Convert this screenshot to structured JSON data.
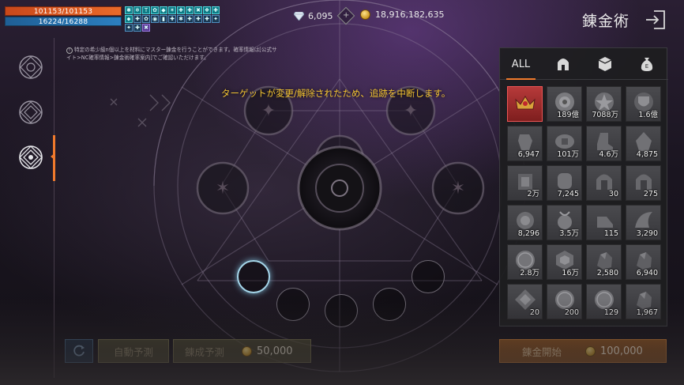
{
  "player": {
    "hp": "101153/101153",
    "mp": "16224/16288"
  },
  "buffs": {
    "row1": [
      "✱",
      "❄",
      "T",
      "✿",
      "◆",
      "✶",
      "✚",
      "✚",
      "✖",
      "❖",
      "✚",
      "⬥"
    ],
    "row2": [
      "✚",
      "✿",
      "◉",
      "▮",
      "✚",
      "✱",
      "✚",
      "✚",
      "✚",
      "✦",
      "✦",
      "✚"
    ],
    "row3": [
      "✖"
    ]
  },
  "currency": {
    "diamonds": "6,095",
    "adena": "18,916,182,635"
  },
  "header": {
    "title": "錬金術"
  },
  "notice": {
    "text": "特定の希少級n個以上を材料にマスター錬金を行うことができます。確率情報は[公式サイト>NC確率情報>錬金術確率案内]でご確認いただけます。"
  },
  "message": {
    "target": "ターゲットが変更/解除されたため、追跡を中断します。"
  },
  "panel": {
    "tabs": [
      {
        "label": "ALL",
        "icon": "all-text"
      },
      {
        "label": "",
        "icon": "helmet-icon"
      },
      {
        "label": "",
        "icon": "cube-icon"
      },
      {
        "label": "",
        "icon": "money-bag-icon"
      }
    ],
    "items": [
      {
        "count": "",
        "selected": true,
        "art": "crown"
      },
      {
        "count": "189億",
        "art": "ring"
      },
      {
        "count": "7088万",
        "art": "medal"
      },
      {
        "count": "1.6億",
        "art": "shield"
      },
      {
        "count": "6,947",
        "art": "gauntlet"
      },
      {
        "count": "101万",
        "art": "belt"
      },
      {
        "count": "4.6万",
        "art": "boot"
      },
      {
        "count": "4,875",
        "art": "cloak"
      },
      {
        "count": "2万",
        "art": "armor"
      },
      {
        "count": "7,245",
        "art": "bracer"
      },
      {
        "count": "30",
        "art": "helm"
      },
      {
        "count": "275",
        "art": "helm"
      },
      {
        "count": "8,296",
        "art": "badge"
      },
      {
        "count": "3.5万",
        "art": "amulet"
      },
      {
        "count": "115",
        "art": "shoe"
      },
      {
        "count": "3,290",
        "art": "wing"
      },
      {
        "count": "2.8万",
        "art": "coin"
      },
      {
        "count": "16万",
        "art": "crest"
      },
      {
        "count": "2,580",
        "art": "ore"
      },
      {
        "count": "6,940",
        "art": "ore"
      },
      {
        "count": "20",
        "art": "scroll"
      },
      {
        "count": "200",
        "art": "coin"
      },
      {
        "count": "129",
        "art": "coin"
      },
      {
        "count": "1,967",
        "art": "ore"
      }
    ]
  },
  "buttons": {
    "auto_predict": "自動予測",
    "smelt_predict": "錬成予測",
    "smelt_cost": "50,000",
    "start": "錬金開始",
    "start_cost": "100,000"
  },
  "colors": {
    "accent": "#f07a2c",
    "gold_text": "#f3c431",
    "hp": "#e0562a",
    "mp": "#2c7fc0"
  }
}
